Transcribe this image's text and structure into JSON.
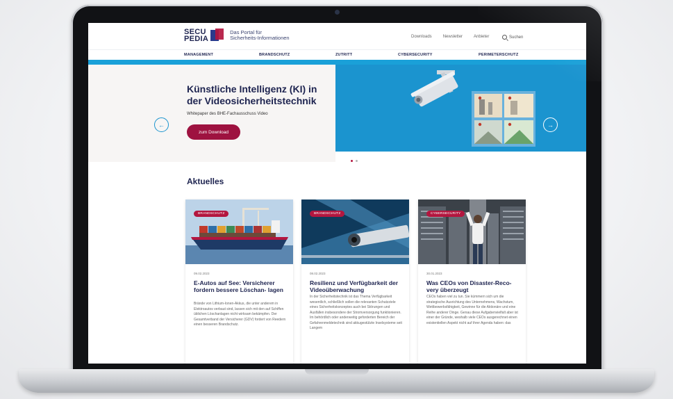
{
  "header": {
    "logo_line1": "SECU",
    "logo_line2": "PEDIA",
    "tagline_line1": "Das Portal für",
    "tagline_line2": "Sicherheits-Informationen",
    "links": [
      "Downloads",
      "Newsletter",
      "Anbieter"
    ],
    "search_label": "Suchen"
  },
  "nav": {
    "items": [
      "MANAGEMENT",
      "BRANDSCHUTZ",
      "ZUTRITT",
      "CYBERSECURITY",
      "PERIMETERSCHUTZ"
    ]
  },
  "hero": {
    "title": "Künstliche Intelligenz (KI) in der Videosicherheitstechnik",
    "subtitle": "Whitepaper des BHE-Fachausschuss Video",
    "button": "zum Download",
    "prev_glyph": "←",
    "next_glyph": "→"
  },
  "section": {
    "title": "Aktuelles"
  },
  "cards": [
    {
      "badge": "BRANDSCHUTZ",
      "date": "09.02.2023",
      "title": "E-Autos auf See: Versicherer fordern bessere Löschan- lagen",
      "body": "Brände von Lithium-Ionen-Akkus, die unter anderem in Elektroautos verbaut sind, lassen sich mit den auf Schiffen üblichen Löschanlagen nicht wirksam bekämpfen. Der Gesamtverband der Versicherer (GDV) fordert von Reedern einen besseren Brandschutz."
    },
    {
      "badge": "BRANDSCHUTZ",
      "date": "08.02.2023",
      "title": "Resilienz und Verfügbarkeit der Videoüberwachung",
      "body": "In der Sicherheitstechnik ist das Thema Verfügbarkeit wesentlich, schließlich sollen die relevanten Schutzziele eines Sicherheitskonzeptes auch bei Störungen und Ausfällen insbesondere der Stromversorgung funktionieren. Im behördlich oder anderweitig geforderten Bereich der Gefahrenmeldetechnik sind akkugestützte Inselsysteme seit Langem"
    },
    {
      "badge": "CYBERSECURITY",
      "date": "30.01.2023",
      "title": "Was CEOs von Disaster-Reco- very überzeugt",
      "body": "CEOs haben viel zu tun. Sie kümmern sich um die strategische Ausrichtung des Unternehmens, Wachstum, Wettbewerbsfähigkeit, Gewinne für die Aktionäre und eine Reihe anderer Dinge. Genau diese Aufgabenvielfalt aber ist einer der Gründe, weshalb viele CEOs ausgerechnet einen existentiellen Aspekt nicht auf ihrer Agenda haben: das"
    }
  ],
  "colors": {
    "brand_navy": "#1e2450",
    "brand_red": "#b3163f",
    "hero_blue": "#1b94cf"
  }
}
